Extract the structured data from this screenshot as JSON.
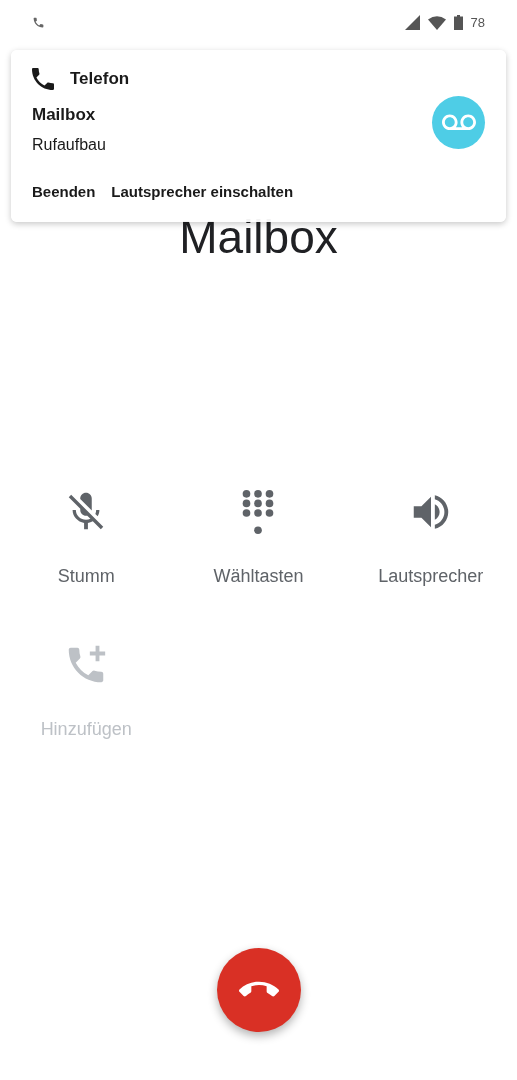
{
  "status_bar": {
    "battery": "78"
  },
  "notification": {
    "app": "Telefon",
    "title": "Mailbox",
    "text": "Rufaufbau",
    "actions": [
      "Beenden",
      "Lautsprecher einschalten"
    ]
  },
  "call": {
    "name": "Mailbox"
  },
  "controls": [
    {
      "kind": "mute",
      "label": "Stumm",
      "disabled": false
    },
    {
      "kind": "dialpad",
      "label": "Wähltasten",
      "disabled": false
    },
    {
      "kind": "speaker",
      "label": "Lautsprecher",
      "disabled": false
    },
    {
      "kind": "add_call",
      "label": "Hinzufügen",
      "disabled": true
    }
  ]
}
